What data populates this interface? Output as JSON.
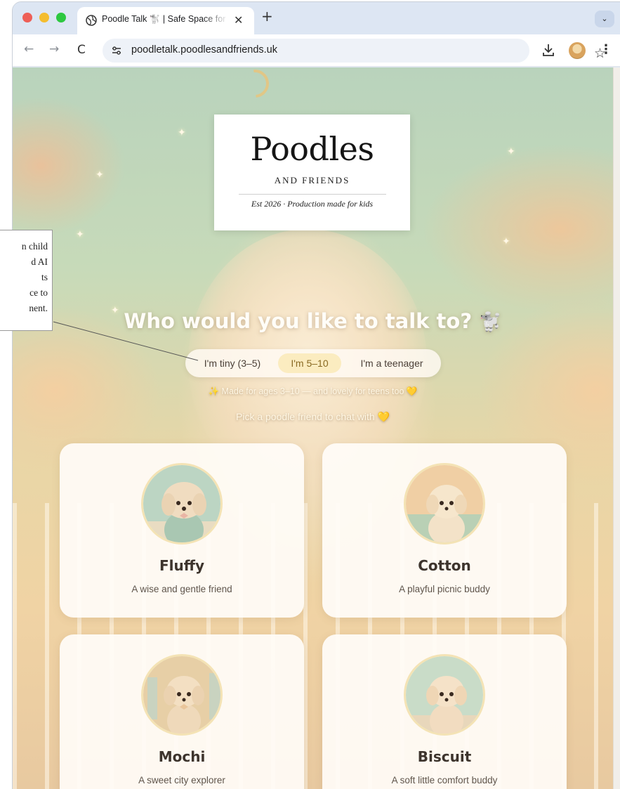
{
  "browser": {
    "tab_title": "Poodle Talk 🐩 | Safe Space for Kids",
    "tab_close": "✕",
    "new_tab": "+",
    "tab_menu": "⌄",
    "url": "poodletalk.poodlesandfriends.uk",
    "nav_back": "←",
    "nav_forward": "→",
    "nav_reload": "C",
    "bookmark": "☆",
    "menu": "⋮"
  },
  "logo": {
    "title": "Poodles",
    "subtitle": "AND FRIENDS",
    "tagline": "Est 2026 · Production made for kids"
  },
  "hero": {
    "headline": "Who would you like to talk to?",
    "headline_icon": "🐩"
  },
  "age_selector": {
    "options": [
      "I'm tiny (3–5)",
      "I'm 5–10",
      "I'm a teenager"
    ],
    "selected": "I'm 5–10"
  },
  "note": "✨ Made for ages 3–10 — and lovely for teens too 💛",
  "pick": "Pick a poodle friend to chat with 💛",
  "characters": [
    {
      "name": "Fluffy",
      "description": "A wise and gentle friend"
    },
    {
      "name": "Cotton",
      "description": "A playful picnic buddy"
    },
    {
      "name": "Mochi",
      "description": "A sweet city explorer"
    },
    {
      "name": "Biscuit",
      "description": "A soft little comfort buddy"
    }
  ],
  "annotation": {
    "lines": [
      "n child",
      "d AI",
      "ts",
      "ce to",
      "nent."
    ]
  },
  "colors": {
    "selected_pill": "#fbecc0",
    "card_bg": "#fffcf8",
    "headline": "#fffdf8"
  }
}
